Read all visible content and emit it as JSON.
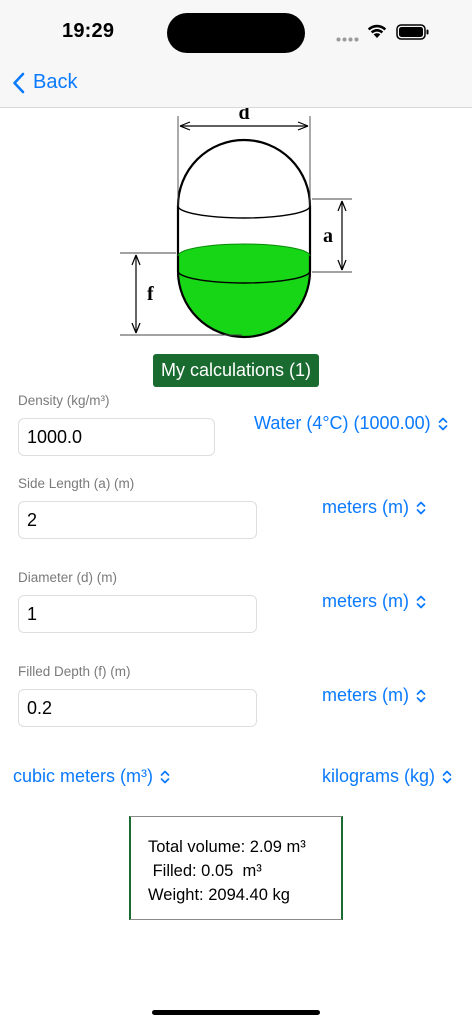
{
  "status": {
    "time": "19:29"
  },
  "nav": {
    "back_label": "Back"
  },
  "diagram": {
    "label_d": "d",
    "label_a": "a",
    "label_f": "f"
  },
  "my_calculations_label": "My calculations (1)",
  "fields": {
    "density": {
      "label": "Density (kg/m³)",
      "value": "1000.0",
      "unit": "Water (4°C) (1000.00)"
    },
    "side_length": {
      "label": "Side Length (a)  (m)",
      "value": "2",
      "unit": "meters (m)"
    },
    "diameter": {
      "label": "Diameter (d)  (m)",
      "value": "1",
      "unit": "meters (m)"
    },
    "filled_depth": {
      "label": "Filled Depth (f)  (m)",
      "value": "0.2",
      "unit": "meters (m)"
    }
  },
  "output_units": {
    "volume": "cubic meters (m³)",
    "weight": "kilograms (kg)"
  },
  "results": {
    "total_volume": "Total volume: 2.09 m³",
    "filled": " Filled: 0.05  m³",
    "weight": "Weight: 2094.40 kg"
  },
  "colors": {
    "accent": "#0a7aff",
    "fill_green": "#16d616",
    "button_green": "#1a6b2f"
  }
}
